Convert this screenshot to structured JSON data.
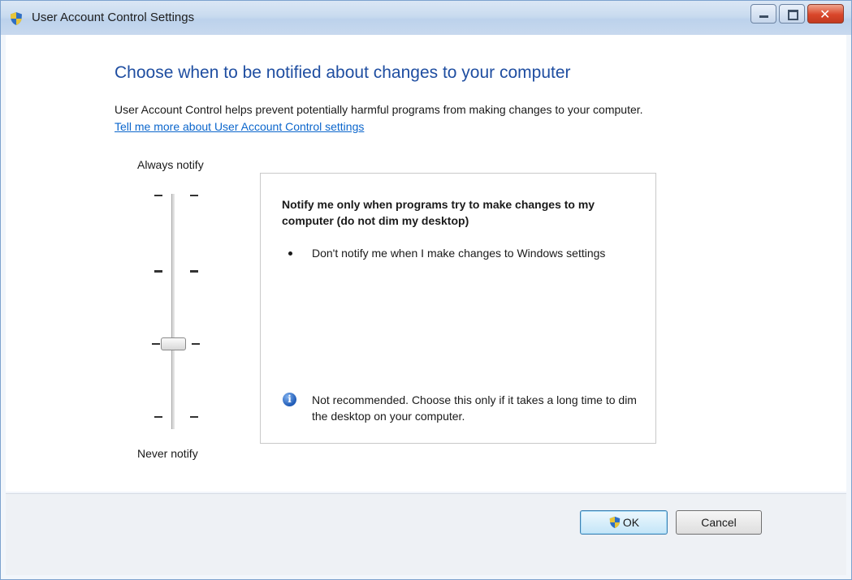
{
  "window": {
    "title": "User Account Control Settings",
    "icon": "uac-shield-icon"
  },
  "main": {
    "heading": "Choose when to be notified about changes to your computer",
    "description": "User Account Control helps prevent potentially harmful programs from making changes to your computer.",
    "link": "Tell me more about User Account Control settings"
  },
  "slider": {
    "top_label": "Always notify",
    "bottom_label": "Never notify",
    "levels": 4,
    "selected_level": 2,
    "selected_level_note": "level index counted from top, 0-based"
  },
  "info": {
    "title": "Notify me only when programs try to make changes to my computer (do not dim my desktop)",
    "bullet": "Don't notify me when I make changes to Windows settings",
    "warning": "Not recommended. Choose this only if it takes a long time to dim the desktop on your computer.",
    "warning_icon": "info-icon"
  },
  "buttons": {
    "ok": "OK",
    "cancel": "Cancel"
  },
  "colors": {
    "heading": "#1f4ea1",
    "link": "#0b66cc",
    "titlebar": "#c9dbef",
    "close_button": "#d9462a"
  }
}
